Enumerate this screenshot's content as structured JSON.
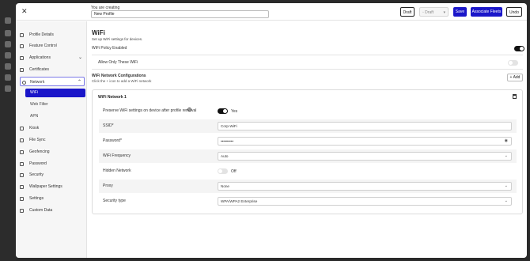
{
  "header": {
    "creating_label": "You are creating",
    "profile_name": "New Profile",
    "draft_label": "Draft",
    "status_label": "Draft",
    "save_label": "Save",
    "associate_label": "Associate Fleets",
    "undo_label": "Undo"
  },
  "nav": {
    "items": [
      {
        "label": "Profile Details"
      },
      {
        "label": "Feature Control"
      },
      {
        "label": "Applications"
      },
      {
        "label": "Certificates"
      },
      {
        "label": "Network"
      },
      {
        "label": "Kiosk"
      },
      {
        "label": "File Sync"
      },
      {
        "label": "Geofencing"
      },
      {
        "label": "Password"
      },
      {
        "label": "Security"
      },
      {
        "label": "Wallpaper Settings"
      },
      {
        "label": "Settings"
      },
      {
        "label": "Custom Data"
      }
    ],
    "network_sub": [
      {
        "label": "WiFi"
      },
      {
        "label": "Web Filter"
      },
      {
        "label": "APN"
      }
    ]
  },
  "wifi": {
    "title": "WiFi",
    "subtitle": "Set up WiFi settings for devices.",
    "policy_label": "WiFi Policy Enabled",
    "policy_enabled": true,
    "allow_only_these_label": "Allow Only These WiFi",
    "allow_only_these_enabled": false,
    "configs_title": "WiFi Network Configurations",
    "configs_hint": "Click the + icon to add a WiFi network",
    "add_label": "+ Add"
  },
  "network1": {
    "title": "WiFi Network 1",
    "preserve_label": "Preserve WiFi settings on device after profile removal",
    "preserve_enabled": true,
    "preserve_state": "Yes",
    "ssid_label": "SSID*",
    "ssid_value": "Corp-WiFi",
    "password_label": "Password*",
    "password_value": "••••••••••",
    "frequency_label": "WiFi Frequency",
    "frequency_value": "Auto",
    "hidden_label": "Hidden Network",
    "hidden_enabled": false,
    "hidden_state": "Off",
    "proxy_label": "Proxy",
    "proxy_value": "None",
    "security_label": "Security type",
    "security_value": "WPA/WPA2 Enterprise"
  }
}
